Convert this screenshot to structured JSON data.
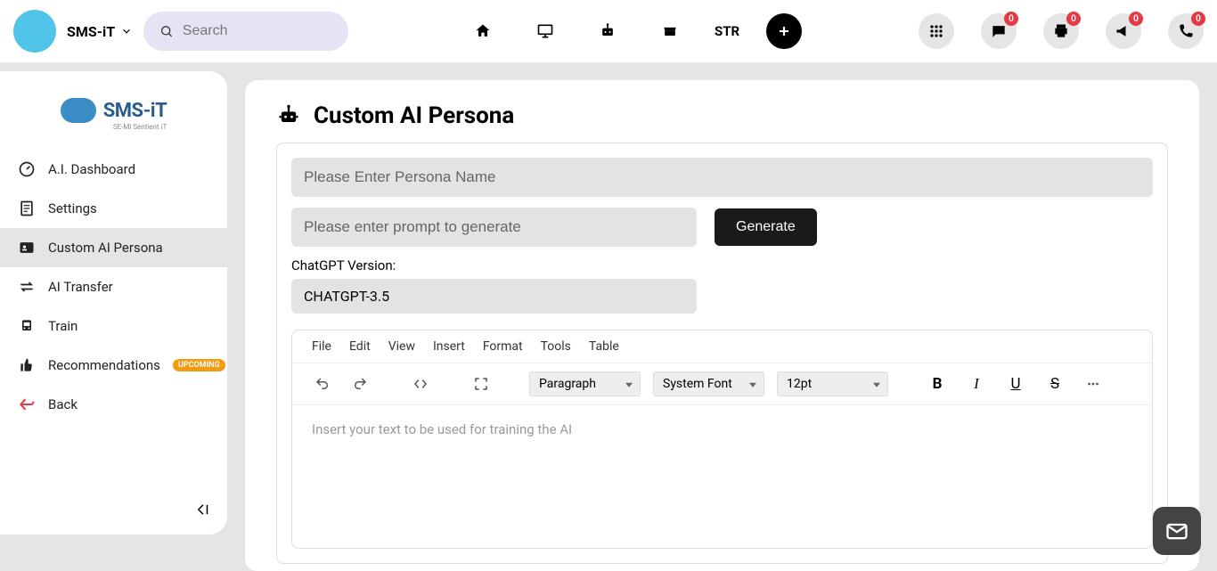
{
  "header": {
    "brand_label": "SMS-iT",
    "search_placeholder": "Search",
    "str_label": "STR",
    "badges": {
      "chat": "0",
      "print": "0",
      "announce": "0",
      "phone": "0"
    }
  },
  "sidebar": {
    "logo_main": "SMS-iT",
    "logo_sub": "SE-Mi Sentient iT",
    "items": [
      {
        "label": "A.I. Dashboard"
      },
      {
        "label": "Settings"
      },
      {
        "label": "Custom AI Persona"
      },
      {
        "label": "AI Transfer"
      },
      {
        "label": "Train"
      },
      {
        "label": "Recommendations",
        "badge": "UPCOMING"
      },
      {
        "label": "Back"
      }
    ]
  },
  "main": {
    "page_title": "Custom AI Persona",
    "persona_name_placeholder": "Please Enter Persona Name",
    "prompt_placeholder": "Please enter prompt to generate",
    "generate_label": "Generate",
    "version_label": "ChatGPT Version:",
    "version_value": "CHATGPT-3.5",
    "editor": {
      "menu": [
        "File",
        "Edit",
        "View",
        "Insert",
        "Format",
        "Tools",
        "Table"
      ],
      "block_format": "Paragraph",
      "font_family": "System Font",
      "font_size": "12pt",
      "placeholder": "Insert your text to be used for training the AI"
    }
  }
}
